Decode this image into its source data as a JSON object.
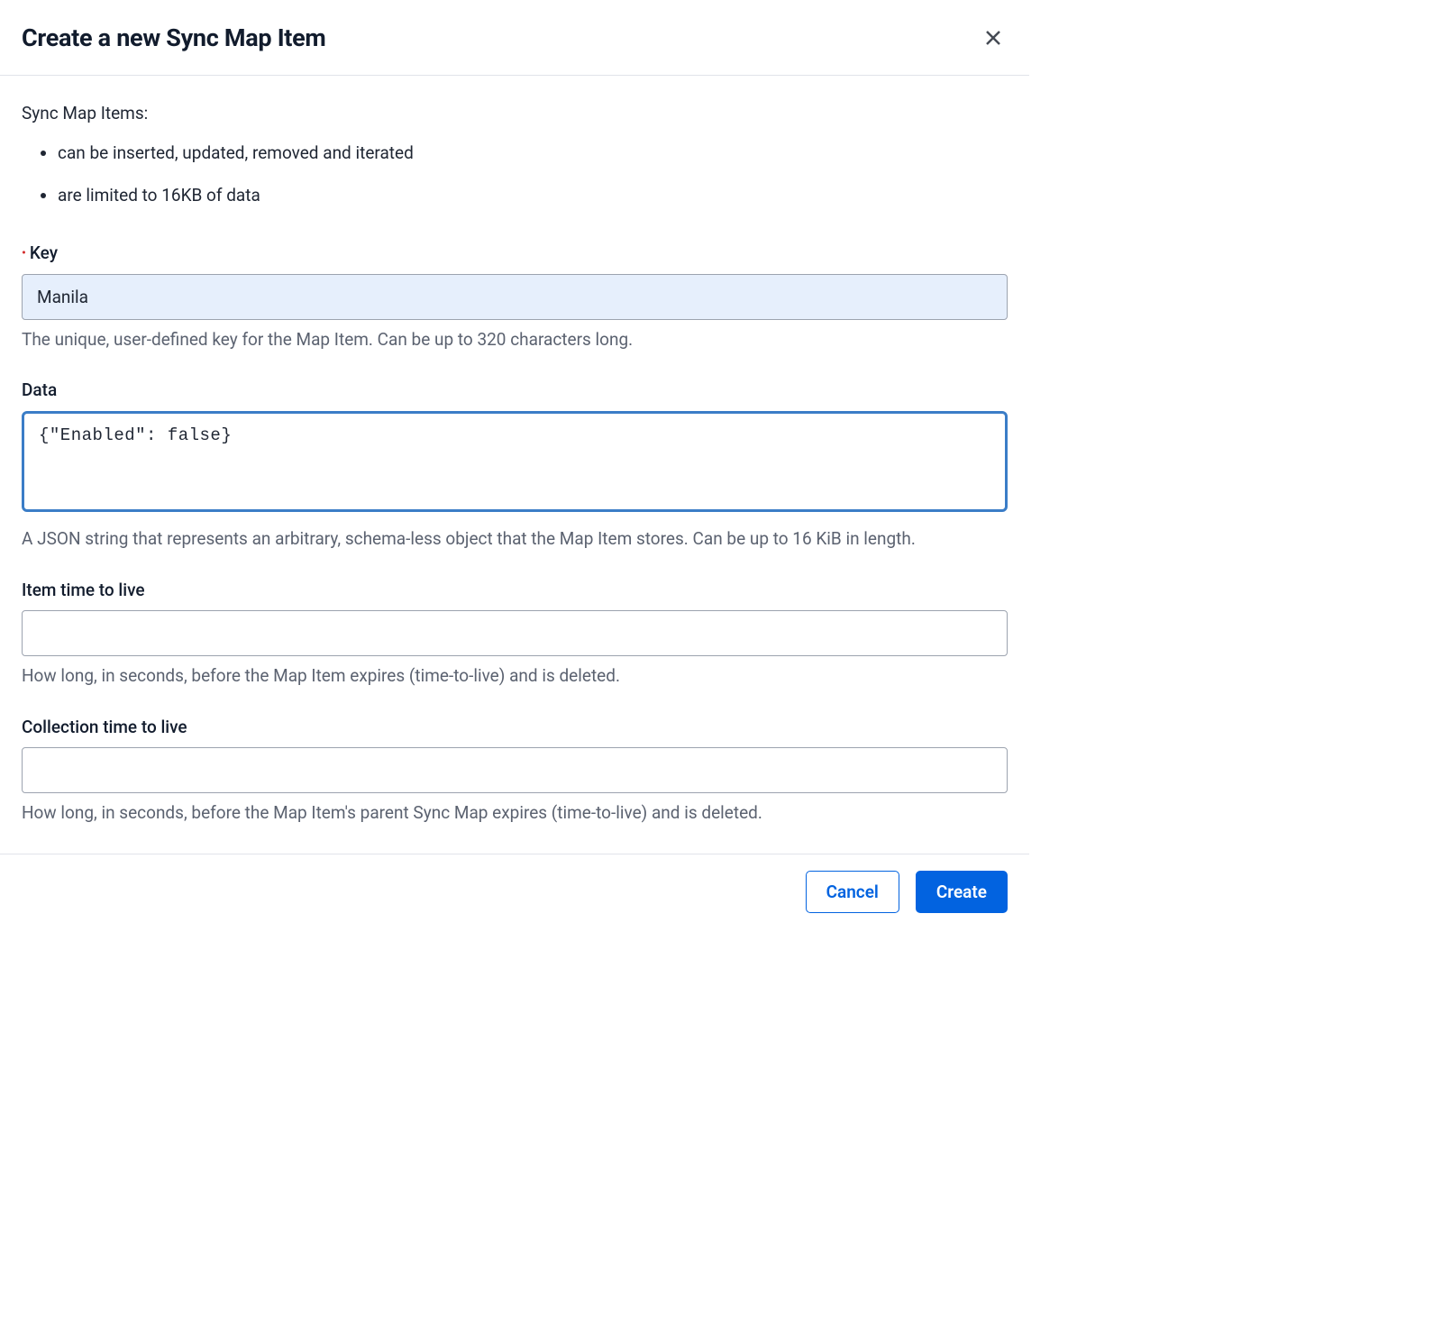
{
  "header": {
    "title": "Create a new Sync Map Item"
  },
  "intro": "Sync Map Items:",
  "bullets": [
    "can be inserted, updated, removed and iterated",
    "are limited to 16KB of data"
  ],
  "fields": {
    "key": {
      "label": "Key",
      "value": "Manila",
      "help": "The unique, user-defined key for the Map Item. Can be up to 320 characters long.",
      "required": true
    },
    "data": {
      "label": "Data",
      "value": "{\"Enabled\": false}",
      "help": "A JSON string that represents an arbitrary, schema-less object that the Map Item stores. Can be up to 16 KiB in length."
    },
    "item_ttl": {
      "label": "Item time to live",
      "value": "",
      "help": "How long, in seconds, before the Map Item expires (time-to-live) and is deleted."
    },
    "collection_ttl": {
      "label": "Collection time to live",
      "value": "",
      "help": "How long, in seconds, before the Map Item's parent Sync Map expires (time-to-live) and is deleted."
    }
  },
  "footer": {
    "cancel": "Cancel",
    "create": "Create"
  }
}
